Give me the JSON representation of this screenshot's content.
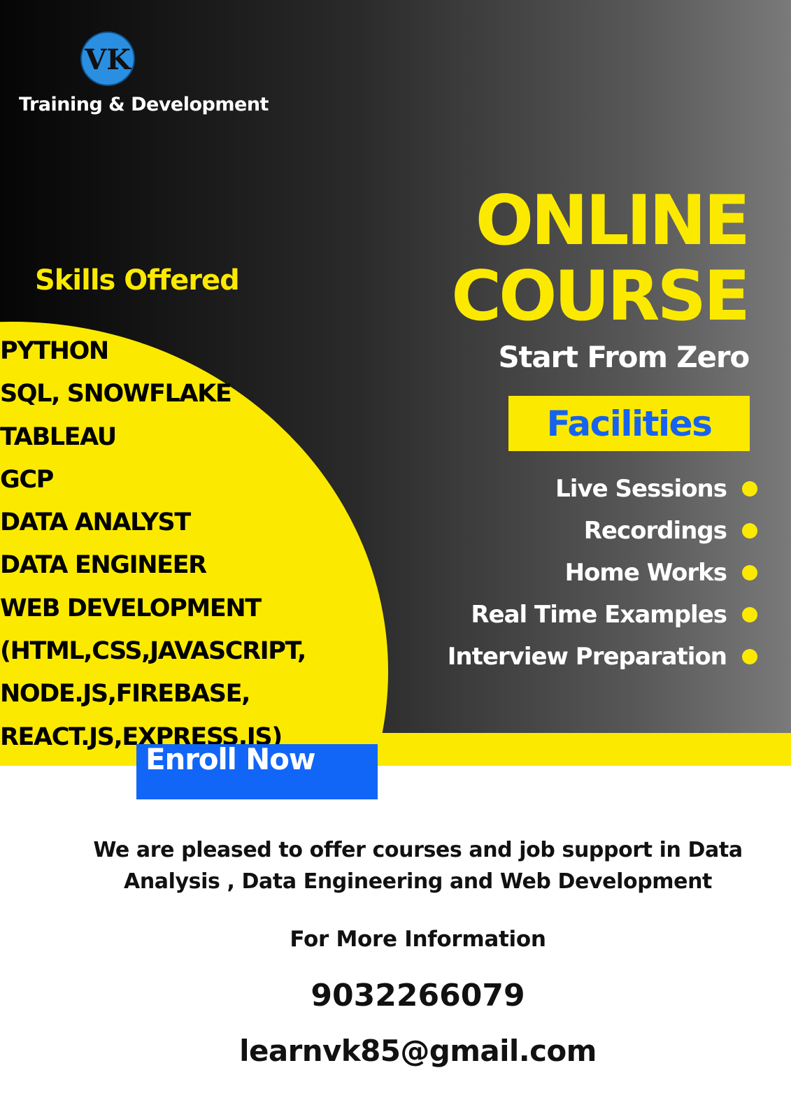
{
  "brand": {
    "logo_text": "VK",
    "tagline": "Training & Development"
  },
  "skills": {
    "heading": "Skills Offered",
    "items": [
      "PYTHON",
      "SQL, SNOWFLAKE",
      "TABLEAU",
      "GCP",
      "DATA ANALYST",
      "DATA ENGINEER",
      "WEB DEVELOPMENT",
      "(HTML,CSS,JAVASCRIPT,",
      "NODE.JS,FIREBASE,",
      "REACT.JS,EXPRESS.JS)"
    ]
  },
  "headline": {
    "line1": "ONLINE",
    "line2": "COURSE",
    "subtitle": "Start From Zero"
  },
  "facilities": {
    "label": "Facilities",
    "items": [
      "Live Sessions",
      "Recordings",
      "Home Works",
      "Real Time Examples",
      "Interview Preparation"
    ]
  },
  "cta": {
    "label": "Enroll Now"
  },
  "info": {
    "intro_line1": "We are pleased  to offer courses and job support in Data",
    "intro_line2": "Analysis , Data Engineering and Web Development",
    "more_info": "For More Information",
    "phone": "9032266079",
    "email": "learnvk85@gmail.com"
  },
  "colors": {
    "accent_yellow": "#fbea00",
    "button_blue": "#1266f7",
    "facilities_blue": "#1762ef",
    "logo_blue": "#2a8fe0"
  }
}
